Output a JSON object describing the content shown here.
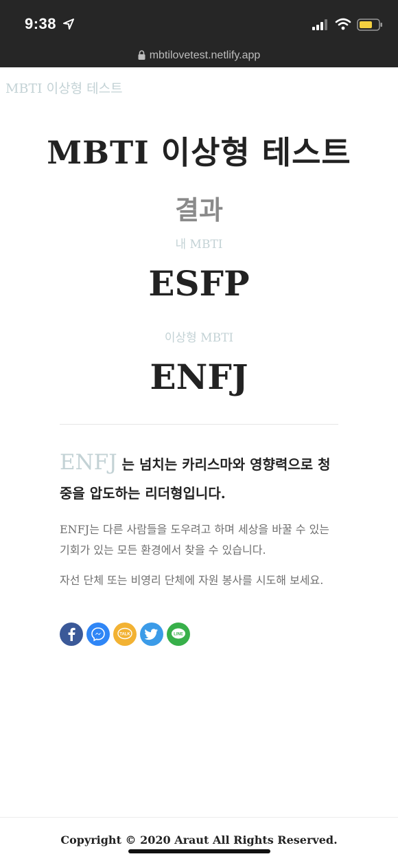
{
  "status_bar": {
    "time": "9:38",
    "url": "mbtilovetest.netlify.app"
  },
  "header": {
    "brand": "MBTI 이상형 테스트"
  },
  "main": {
    "title": "MBTI 이상형 테스트",
    "result_heading": "결과",
    "my_mbti_label": "내 MBTI",
    "my_mbti_value": "ESFP",
    "ideal_mbti_label": "이상형 MBTI",
    "ideal_mbti_value": "ENFJ"
  },
  "description": {
    "type_name": "ENFJ",
    "headline": " 는 넘치는 카리스마와 영향력으로 청중을 압도하는 리더형입니다.",
    "paragraph1": "ENFJ는 다른 사람들을 도우려고 하며 세상을 바꿀 수 있는 기회가 있는 모든 환경에서 찾을 수 있습니다.",
    "paragraph2": "자선 단체 또는 비영리 단체에 자원 봉사를 시도해 보세요."
  },
  "share": {
    "kakao_text": "TALK",
    "line_text": "LINE"
  },
  "footer": {
    "copyright": "Copyright © 2020 Araut All Rights Reserved."
  },
  "colors": {
    "accent": "#c3d2d5",
    "status_bar_bg": "#262626",
    "facebook": "#3b5998",
    "messenger": "#2f86f6",
    "kakao": "#f2b233",
    "twitter": "#3b9be8",
    "line": "#38b04a"
  },
  "icons": [
    "location-arrow-icon",
    "signal-icon",
    "wifi-icon",
    "battery-icon",
    "lock-icon",
    "facebook-icon",
    "messenger-icon",
    "kakaotalk-icon",
    "twitter-icon",
    "line-icon"
  ]
}
